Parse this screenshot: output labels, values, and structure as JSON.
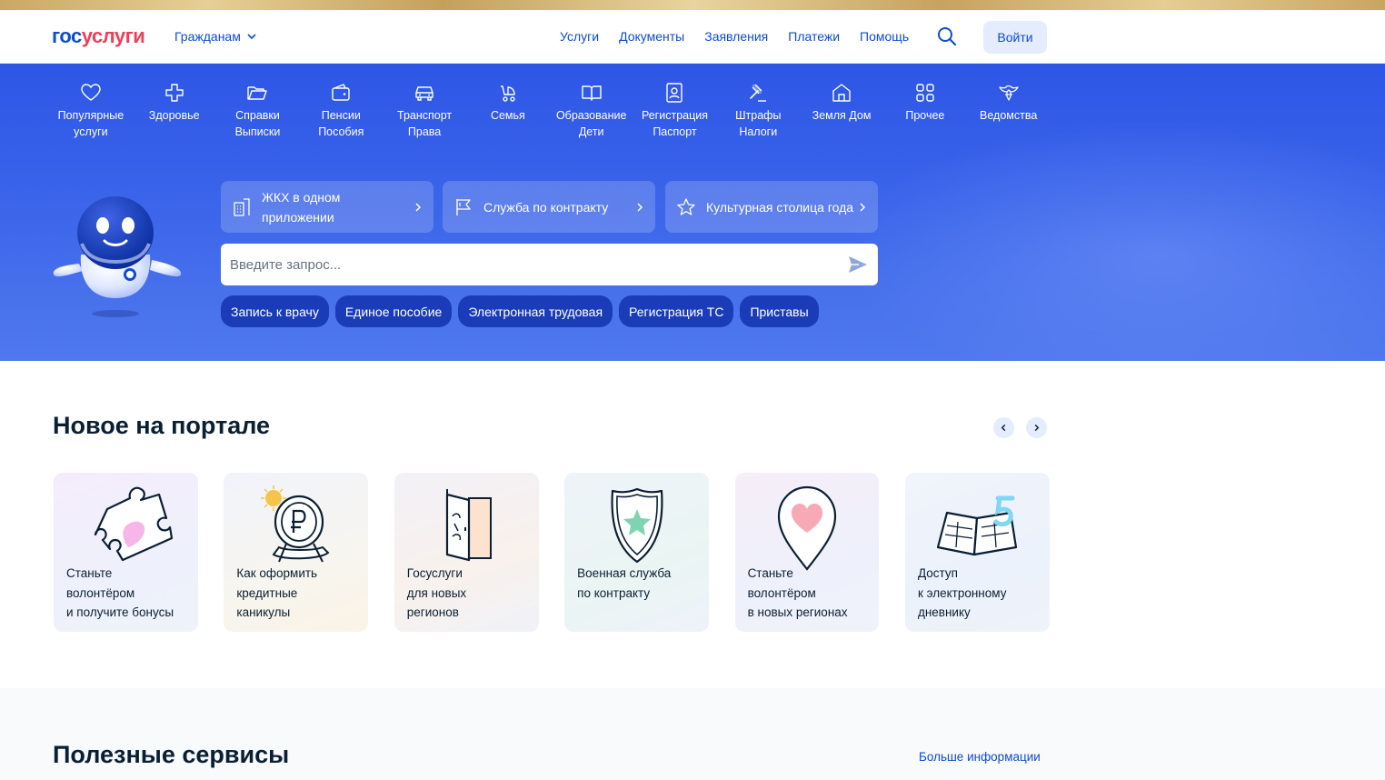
{
  "header": {
    "logo_part1": "гос",
    "logo_part2": "услуги",
    "audience": "Гражданам",
    "nav": [
      "Услуги",
      "Документы",
      "Заявления",
      "Платежи",
      "Помощь"
    ],
    "login": "Войти"
  },
  "categories": [
    {
      "icon": "heart-icon",
      "lines": [
        "Популярные",
        "услуги"
      ]
    },
    {
      "icon": "medical-cross-icon",
      "lines": [
        "Здоровье"
      ]
    },
    {
      "icon": "folder-icon",
      "lines": [
        "Справки",
        "Выписки"
      ]
    },
    {
      "icon": "wallet-icon",
      "lines": [
        "Пенсии",
        "Пособия"
      ]
    },
    {
      "icon": "car-icon",
      "lines": [
        "Транспорт",
        "Права"
      ]
    },
    {
      "icon": "stroller-icon",
      "lines": [
        "Семья"
      ]
    },
    {
      "icon": "book-icon",
      "lines": [
        "Образование",
        "Дети"
      ]
    },
    {
      "icon": "passport-icon",
      "lines": [
        "Регистрация",
        "Паспорт"
      ]
    },
    {
      "icon": "gavel-icon",
      "lines": [
        "Штрафы",
        "Налоги"
      ]
    },
    {
      "icon": "house-icon",
      "lines": [
        "Земля Дом"
      ]
    },
    {
      "icon": "grid-icon",
      "lines": [
        "Прочее"
      ]
    },
    {
      "icon": "eagle-icon",
      "lines": [
        "Ведомства"
      ]
    }
  ],
  "promos": [
    {
      "icon": "building-icon",
      "text": "ЖКХ в одном приложении"
    },
    {
      "icon": "flag-icon",
      "text": "Служба по контракту"
    },
    {
      "icon": "star-icon",
      "text": "Культурная столица года"
    }
  ],
  "search": {
    "placeholder": "Введите запрос..."
  },
  "quick_links": [
    "Запись к врачу",
    "Единое пособие",
    "Электронная трудовая",
    "Регистрация ТС",
    "Приставы"
  ],
  "news": {
    "title": "Новое на портале",
    "cards": [
      {
        "icon": "puzzle-icon",
        "lines": [
          "Станьте",
          "волонтёром",
          "и получите бонусы"
        ]
      },
      {
        "icon": "ruble-coin-icon",
        "lines": [
          "Как оформить",
          "кредитные",
          "каникулы"
        ]
      },
      {
        "icon": "door-icon",
        "lines": [
          "Госуслуги",
          "для новых",
          "регионов"
        ]
      },
      {
        "icon": "shield-star-icon",
        "lines": [
          "Военная служба",
          "по контракту"
        ]
      },
      {
        "icon": "location-heart-icon",
        "lines": [
          "Станьте",
          "волонтёром",
          "в новых регионах"
        ]
      },
      {
        "icon": "diary-icon",
        "lines": [
          "Доступ",
          "к электронному",
          "дневнику"
        ]
      }
    ]
  },
  "useful": {
    "title": "Полезные сервисы",
    "more": "Больше информации"
  },
  "colors": {
    "brand_blue": "#0d4cd3",
    "brand_red": "#ee3f58",
    "hero_blue": "#2d56e6",
    "chip_blue": "#1a3cb8"
  }
}
